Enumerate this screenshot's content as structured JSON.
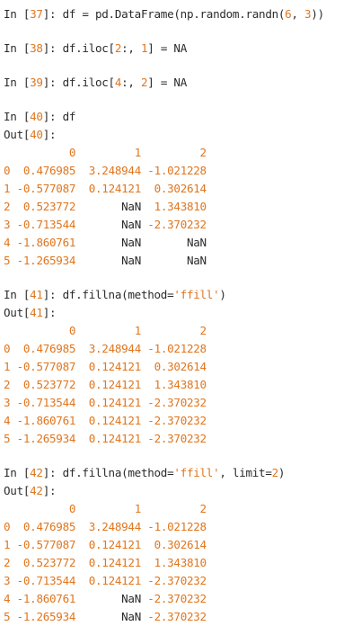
{
  "colors": {
    "text": "#2b2b2b",
    "accent_orange": "#e0761e",
    "background": "#ffffff"
  },
  "cells": [
    {
      "in_prefix": "In [",
      "in_number": "37",
      "in_suffix": "]: ",
      "code_parts": [
        {
          "text": "df = pd.DataFrame(np.random.randn(",
          "kind": "code"
        },
        {
          "text": "6",
          "kind": "num"
        },
        {
          "text": ", ",
          "kind": "code"
        },
        {
          "text": "3",
          "kind": "num"
        },
        {
          "text": "))",
          "kind": "code"
        }
      ]
    },
    {
      "in_prefix": "In [",
      "in_number": "38",
      "in_suffix": "]: ",
      "code_parts": [
        {
          "text": "df.iloc[",
          "kind": "code"
        },
        {
          "text": "2",
          "kind": "num"
        },
        {
          "text": ":, ",
          "kind": "code"
        },
        {
          "text": "1",
          "kind": "num"
        },
        {
          "text": "] = NA",
          "kind": "code"
        }
      ]
    },
    {
      "in_prefix": "In [",
      "in_number": "39",
      "in_suffix": "]: ",
      "code_parts": [
        {
          "text": "df.iloc[",
          "kind": "code"
        },
        {
          "text": "4",
          "kind": "num"
        },
        {
          "text": ":, ",
          "kind": "code"
        },
        {
          "text": "2",
          "kind": "num"
        },
        {
          "text": "] = NA",
          "kind": "code"
        }
      ]
    },
    {
      "in_prefix": "In [",
      "in_number": "40",
      "in_suffix": "]: ",
      "code_parts": [
        {
          "text": "df",
          "kind": "code"
        }
      ],
      "out_prefix": "Out[",
      "out_number": "40",
      "out_suffix": "]:",
      "table": {
        "columns": [
          "0",
          "1",
          "2"
        ],
        "rows": [
          {
            "index": "0",
            "values": [
              "0.476985",
              "3.248944",
              "-1.021228"
            ]
          },
          {
            "index": "1",
            "values": [
              "-0.577087",
              "0.124121",
              "0.302614"
            ]
          },
          {
            "index": "2",
            "values": [
              "0.523772",
              "NaN",
              "1.343810"
            ]
          },
          {
            "index": "3",
            "values": [
              "-0.713544",
              "NaN",
              "-2.370232"
            ]
          },
          {
            "index": "4",
            "values": [
              "-1.860761",
              "NaN",
              "NaN"
            ]
          },
          {
            "index": "5",
            "values": [
              "-1.265934",
              "NaN",
              "NaN"
            ]
          }
        ]
      }
    },
    {
      "in_prefix": "In [",
      "in_number": "41",
      "in_suffix": "]: ",
      "code_parts": [
        {
          "text": "df.fillna(method=",
          "kind": "code"
        },
        {
          "text": "'ffill'",
          "kind": "str"
        },
        {
          "text": ")",
          "kind": "code"
        }
      ],
      "out_prefix": "Out[",
      "out_number": "41",
      "out_suffix": "]:",
      "table": {
        "columns": [
          "0",
          "1",
          "2"
        ],
        "rows": [
          {
            "index": "0",
            "values": [
              "0.476985",
              "3.248944",
              "-1.021228"
            ]
          },
          {
            "index": "1",
            "values": [
              "-0.577087",
              "0.124121",
              "0.302614"
            ]
          },
          {
            "index": "2",
            "values": [
              "0.523772",
              "0.124121",
              "1.343810"
            ]
          },
          {
            "index": "3",
            "values": [
              "-0.713544",
              "0.124121",
              "-2.370232"
            ]
          },
          {
            "index": "4",
            "values": [
              "-1.860761",
              "0.124121",
              "-2.370232"
            ]
          },
          {
            "index": "5",
            "values": [
              "-1.265934",
              "0.124121",
              "-2.370232"
            ]
          }
        ]
      }
    },
    {
      "in_prefix": "In [",
      "in_number": "42",
      "in_suffix": "]: ",
      "code_parts": [
        {
          "text": "df.fillna(method=",
          "kind": "code"
        },
        {
          "text": "'ffill'",
          "kind": "str"
        },
        {
          "text": ", limit=",
          "kind": "code"
        },
        {
          "text": "2",
          "kind": "num"
        },
        {
          "text": ")",
          "kind": "code"
        }
      ],
      "out_prefix": "Out[",
      "out_number": "42",
      "out_suffix": "]:",
      "table": {
        "columns": [
          "0",
          "1",
          "2"
        ],
        "rows": [
          {
            "index": "0",
            "values": [
              "0.476985",
              "3.248944",
              "-1.021228"
            ]
          },
          {
            "index": "1",
            "values": [
              "-0.577087",
              "0.124121",
              "0.302614"
            ]
          },
          {
            "index": "2",
            "values": [
              "0.523772",
              "0.124121",
              "1.343810"
            ]
          },
          {
            "index": "3",
            "values": [
              "-0.713544",
              "0.124121",
              "-2.370232"
            ]
          },
          {
            "index": "4",
            "values": [
              "-1.860761",
              "NaN",
              "-2.370232"
            ]
          },
          {
            "index": "5",
            "values": [
              "-1.265934",
              "NaN",
              "-2.370232"
            ]
          }
        ]
      }
    }
  ]
}
